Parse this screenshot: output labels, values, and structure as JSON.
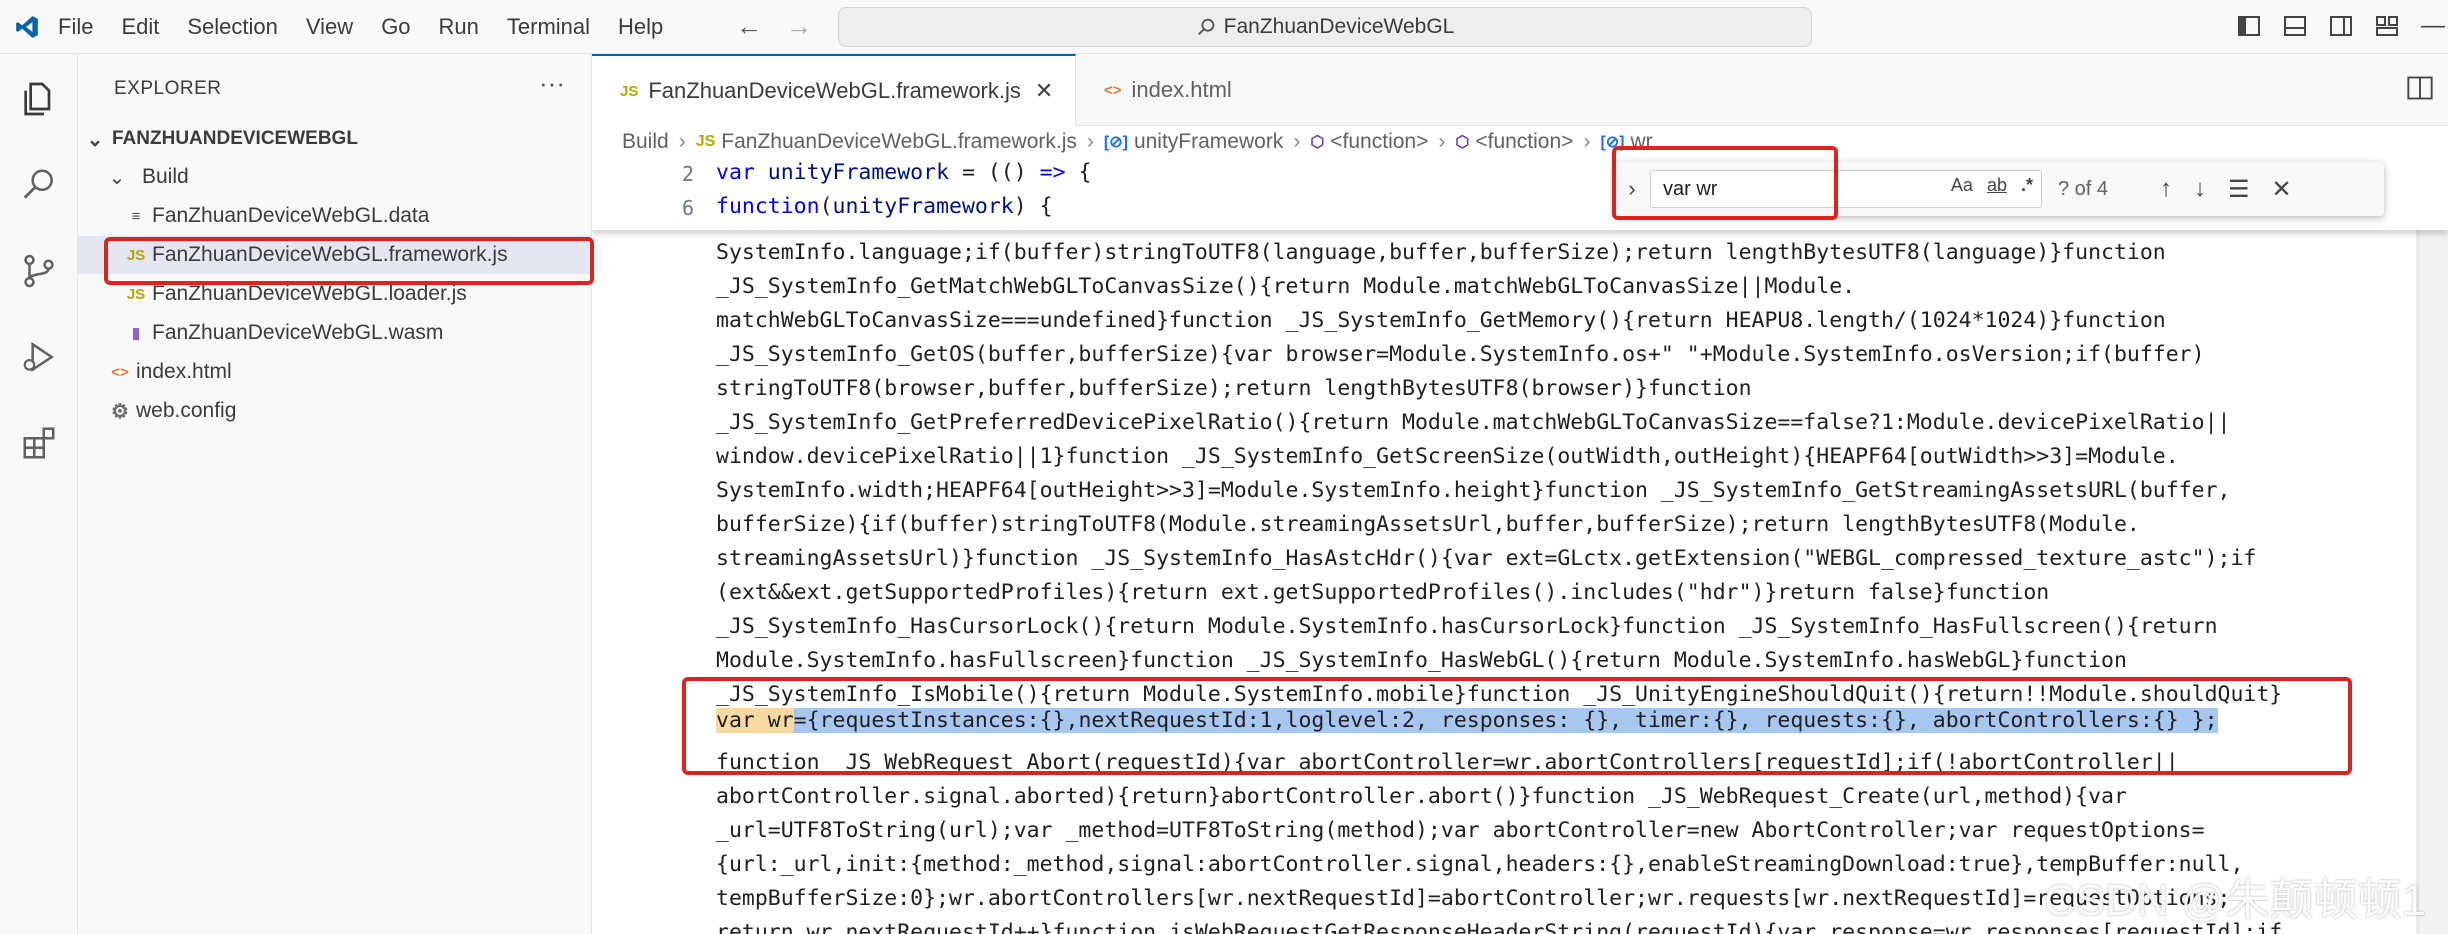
{
  "titlebar": {
    "menu": [
      "File",
      "Edit",
      "Selection",
      "View",
      "Go",
      "Run",
      "Terminal",
      "Help"
    ],
    "command_center": "FanZhuanDeviceWebGL"
  },
  "activity_icons": [
    "explorer-icon",
    "search-icon",
    "source-control-icon",
    "run-debug-icon",
    "extensions-icon"
  ],
  "sidebar": {
    "title": "EXPLORER",
    "root": "FANZHUANDEVICEWEBGL",
    "items": [
      {
        "label": "Build",
        "kind": "folder",
        "depth": 1
      },
      {
        "label": "FanZhuanDeviceWebGL.data",
        "kind": "data",
        "depth": 2,
        "icon_text": "≡"
      },
      {
        "label": "FanZhuanDeviceWebGL.framework.js",
        "kind": "js",
        "depth": 2,
        "icon_text": "JS"
      },
      {
        "label": "FanZhuanDeviceWebGL.loader.js",
        "kind": "js",
        "depth": 2,
        "icon_text": "JS"
      },
      {
        "label": "FanZhuanDeviceWebGL.wasm",
        "kind": "wasm",
        "depth": 2,
        "icon_text": "▮"
      },
      {
        "label": "index.html",
        "kind": "html",
        "depth": 1,
        "icon_text": "<>"
      },
      {
        "label": "web.config",
        "kind": "cfg",
        "depth": 1,
        "icon_text": "⚙"
      }
    ]
  },
  "tabs": [
    {
      "label": "FanZhuanDeviceWebGL.framework.js",
      "icon_text": "JS",
      "active": true
    },
    {
      "label": "index.html",
      "icon_text": "<>",
      "active": false
    }
  ],
  "breadcrumb": [
    "Build",
    "FanZhuanDeviceWebGL.framework.js",
    "unityFramework",
    "<function>",
    "<function>",
    "wr"
  ],
  "sticky_lines": [
    {
      "num": "2",
      "text": "var unityFramework = (() => {"
    },
    {
      "num": "6",
      "text": "function(unityFramework) {"
    }
  ],
  "code_lines": [
    "SystemInfo.language;if(buffer)stringToUTF8(language,buffer,bufferSize);return lengthBytesUTF8(language)}function",
    "_JS_SystemInfo_GetMatchWebGLToCanvasSize(){return Module.matchWebGLToCanvasSize||Module.",
    "matchWebGLToCanvasSize===undefined}function _JS_SystemInfo_GetMemory(){return HEAPU8.length/(1024*1024)}function",
    "_JS_SystemInfo_GetOS(buffer,bufferSize){var browser=Module.SystemInfo.os+\" \"+Module.SystemInfo.osVersion;if(buffer)",
    "stringToUTF8(browser,buffer,bufferSize);return lengthBytesUTF8(browser)}function",
    "_JS_SystemInfo_GetPreferredDevicePixelRatio(){return Module.matchWebGLToCanvasSize==false?1:Module.devicePixelRatio||",
    "window.devicePixelRatio||1}function _JS_SystemInfo_GetScreenSize(outWidth,outHeight){HEAPF64[outWidth>>3]=Module.",
    "SystemInfo.width;HEAPF64[outHeight>>3]=Module.SystemInfo.height}function _JS_SystemInfo_GetStreamingAssetsURL(buffer,",
    "bufferSize){if(buffer)stringToUTF8(Module.streamingAssetsUrl,buffer,bufferSize);return lengthBytesUTF8(Module.",
    "streamingAssetsUrl)}function _JS_SystemInfo_HasAstcHdr(){var ext=GLctx.getExtension(\"WEBGL_compressed_texture_astc\");if",
    "(ext&&ext.getSupportedProfiles){return ext.getSupportedProfiles().includes(\"hdr\")}return false}function",
    "_JS_SystemInfo_HasCursorLock(){return Module.SystemInfo.hasCursorLock}function _JS_SystemInfo_HasFullscreen(){return",
    "Module.SystemInfo.hasFullscreen}function _JS_SystemInfo_HasWebGL(){return Module.SystemInfo.hasWebGL}function",
    "_JS_SystemInfo_IsMobile(){return Module.SystemInfo.mobile}function _JS_UnityEngineShouldQuit(){return!!Module.shouldQuit}",
    "",
    "function _JS_WebRequest_Abort(requestId){var abortController=wr.abortControllers[requestId];if(!abortController||",
    "abortController.signal.aborted){return}abortController.abort()}function _JS_WebRequest_Create(url,method){var",
    "_url=UTF8ToString(url);var _method=UTF8ToString(method);var abortController=new AbortController;var requestOptions=",
    "{url:_url,init:{method:_method,signal:abortController.signal,headers:{},enableStreamingDownload:true},tempBuffer:null,",
    "tempBufferSize:0};wr.abortControllers[wr.nextRequestId]=abortController;wr.requests[wr.nextRequestId]=requestOptions;",
    "return wr.nextRequestId++}function jsWebRequestGetResponseHeaderString(requestId){var response=wr.responses[requestId];if"
  ],
  "highlight_line": {
    "match": "var wr",
    "rest": "={requestInstances:{},nextRequestId:1,loglevel:2, responses: {}, timer:{}, requests:{}, abortControllers:{} };"
  },
  "find": {
    "query": "var wr",
    "opt_case": "Aa",
    "opt_word": "ab",
    "opt_regex": ".*",
    "count": "? of 4"
  },
  "watermark": "CSDN @朱颠顿顿1",
  "colors": {
    "accent": "#005fb8",
    "annotation": "#e0221f",
    "selection": "#a8c7f0"
  }
}
